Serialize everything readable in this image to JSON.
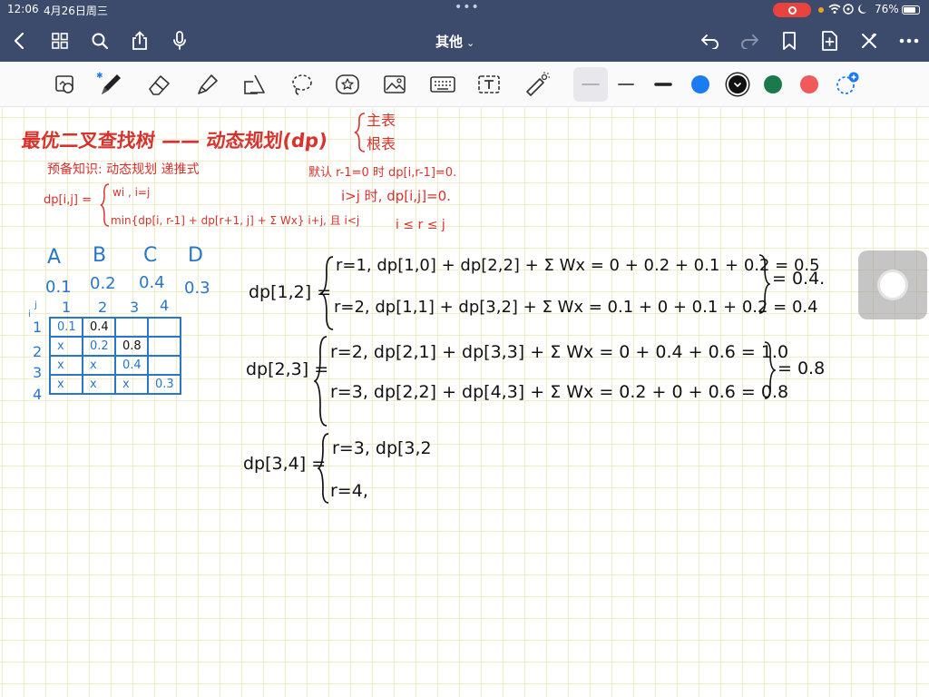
{
  "status_bar": {
    "time": "12:06",
    "date": "4月26日周三",
    "battery": "76%"
  },
  "nav": {
    "title": "其他"
  },
  "colors": {
    "bar_bg": "#3c4a6b",
    "ink_red": "#d8322d",
    "ink_blue": "#2877c9",
    "ink_black": "#111111",
    "swatch_blue": "#1a7cf0",
    "swatch_black": "#111111",
    "swatch_green": "#1a7a4b",
    "swatch_red": "#f05a5a"
  },
  "toolbar": {
    "tools": [
      "lasso-image-icon",
      "pen-icon",
      "eraser-icon",
      "highlighter-icon",
      "shapes-icon",
      "lasso-icon",
      "sticker-icon",
      "image-icon",
      "keyboard-icon",
      "text-box-icon",
      "laser-pointer-icon"
    ]
  },
  "notes": {
    "title": "最优二叉查找树 —— 动态规划(dp)",
    "title_side_1": "主表",
    "title_side_2": "根表",
    "prereq": "预备知识: 动态规划 递推式",
    "default_rule": "默认 r-1=0 时 dp[i,r-1]=0.",
    "rule_i_gt_j": "i>j 时, dp[i,j]=0.",
    "recurrence_lhs": "dp[i,j] =",
    "recurrence_case1": "wi , i=j",
    "recurrence_case2": "min{dp[i, r-1] + dp[r+1, j] + Σ Wx}  i+j, 且 i<j",
    "range": "i ≤ r ≤ j",
    "keys": [
      "A",
      "B",
      "C",
      "D"
    ],
    "probs": [
      "0.1",
      "0.2",
      "0.4",
      "0.3"
    ],
    "grid_corner_i": "i",
    "grid_corner_j": "j",
    "grid_cols": [
      "1",
      "2",
      "3",
      "4"
    ],
    "grid_rows": [
      "1",
      "2",
      "3",
      "4"
    ],
    "grid": [
      [
        "0.1",
        "0.4",
        "",
        ""
      ],
      [
        "x",
        "0.2",
        "0.8",
        ""
      ],
      [
        "x",
        "x",
        "0.4",
        ""
      ],
      [
        "x",
        "x",
        "x",
        "0.3"
      ]
    ],
    "dp12_lhs": "dp[1,2] =",
    "dp12_line1": "r=1, dp[1,0] + dp[2,2] + Σ Wx = 0 + 0.2 + 0.1 + 0.2 = 0.5",
    "dp12_line2": "r=2, dp[1,1] + dp[3,2] + Σ Wx = 0.1 + 0 + 0.1 + 0.2 = 0.4",
    "dp12_result": "= 0.4.",
    "dp23_lhs": "dp[2,3] =",
    "dp23_line1": "r=2, dp[2,1] + dp[3,3] + Σ Wx = 0 + 0.4 + 0.6 = 1.0",
    "dp23_line2": "r=3, dp[2,2] + dp[4,3] + Σ Wx = 0.2 + 0 + 0.6 = 0.8",
    "dp23_result": "= 0.8",
    "dp34_lhs": "dp[3,4] =",
    "dp34_line1": "r=3, dp[3,2",
    "dp34_line2": "r=4,"
  }
}
